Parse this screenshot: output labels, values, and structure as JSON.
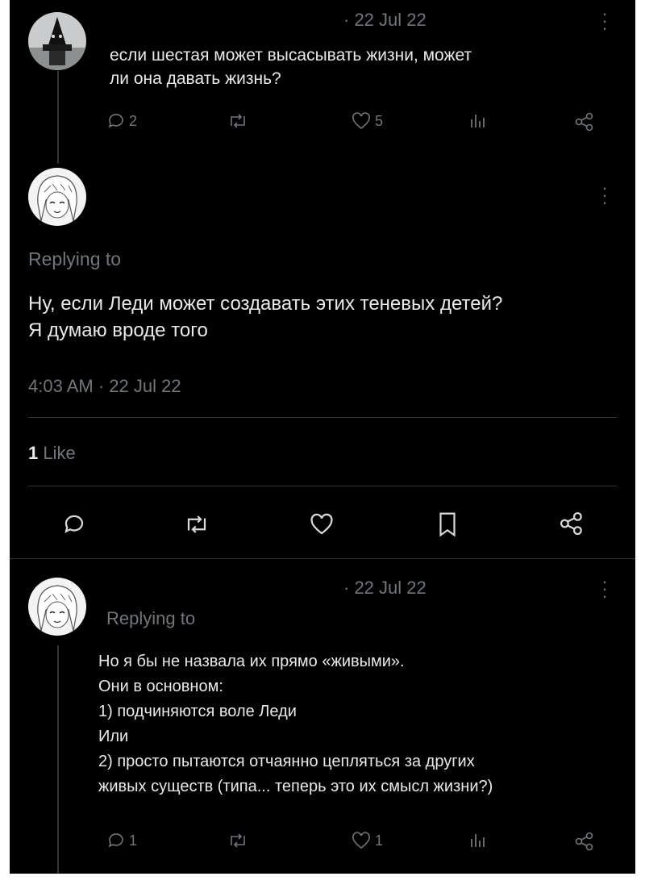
{
  "tweet1": {
    "date": "· 22 Jul 22",
    "text_line1": "если шестая может высасывать жизни, может",
    "text_line2": "ли она давать жизнь?",
    "replies": "2",
    "likes": "5"
  },
  "tweet2": {
    "replying_to": "Replying to",
    "text_line1": "Ну, если Леди может создавать этих теневых детей?",
    "text_line2": "Я думаю вроде того",
    "timestamp": "4:03 AM · 22 Jul 22",
    "like_count": "1",
    "like_label": "Like"
  },
  "tweet3": {
    "date": "· 22 Jul 22",
    "replying_to": "Replying to",
    "lines": [
      "Но я бы не назвала их прямо «живыми».",
      "Они в основном:",
      "1) подчиняются воле Леди",
      "Или",
      "2) просто пытаются отчаянно цепляться за других",
      "живых существ (типа... теперь это их смысл жизни?)"
    ],
    "replies": "1",
    "likes": "1"
  },
  "colors": {
    "background": "#000000",
    "text": "#e7e9ea",
    "muted": "#71767b",
    "divider": "#2f3336"
  }
}
